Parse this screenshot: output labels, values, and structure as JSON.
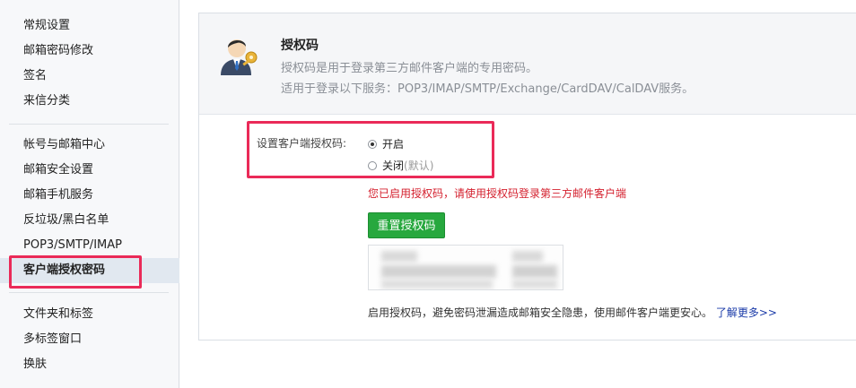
{
  "sidebar": {
    "group1": [
      "常规设置",
      "邮箱密码修改",
      "签名",
      "来信分类"
    ],
    "group2": [
      "帐号与邮箱中心",
      "邮箱安全设置",
      "邮箱手机服务",
      "反垃圾/黑白名单",
      "POP3/SMTP/IMAP",
      "客户端授权密码"
    ],
    "group3": [
      "文件夹和标签",
      "多标签窗口",
      "换肤"
    ],
    "active_item": "客户端授权密码"
  },
  "panel": {
    "title": "授权码",
    "desc1": "授权码是用于登录第三方邮件客户端的专用密码。",
    "desc2": "适用于登录以下服务：POP3/IMAP/SMTP/Exchange/CardDAV/CalDAV服务。",
    "setting_label": "设置客户端授权码:",
    "option_on": "开启",
    "option_off": "关闭",
    "option_off_hint": "(默认)",
    "selected_option": "开启",
    "status_message": "您已启用授权码，请使用授权码登录第三方邮件客户端",
    "reset_button": "重置授权码",
    "footer_text": "启用授权码，避免密码泄漏造成邮箱安全隐患，使用邮件客户端更安心。",
    "footer_link": "了解更多>>"
  },
  "colors": {
    "highlight": "#ea2a58",
    "button_green": "#27a83e",
    "status_red": "#d4202e",
    "link_blue": "#1a3aa8"
  }
}
